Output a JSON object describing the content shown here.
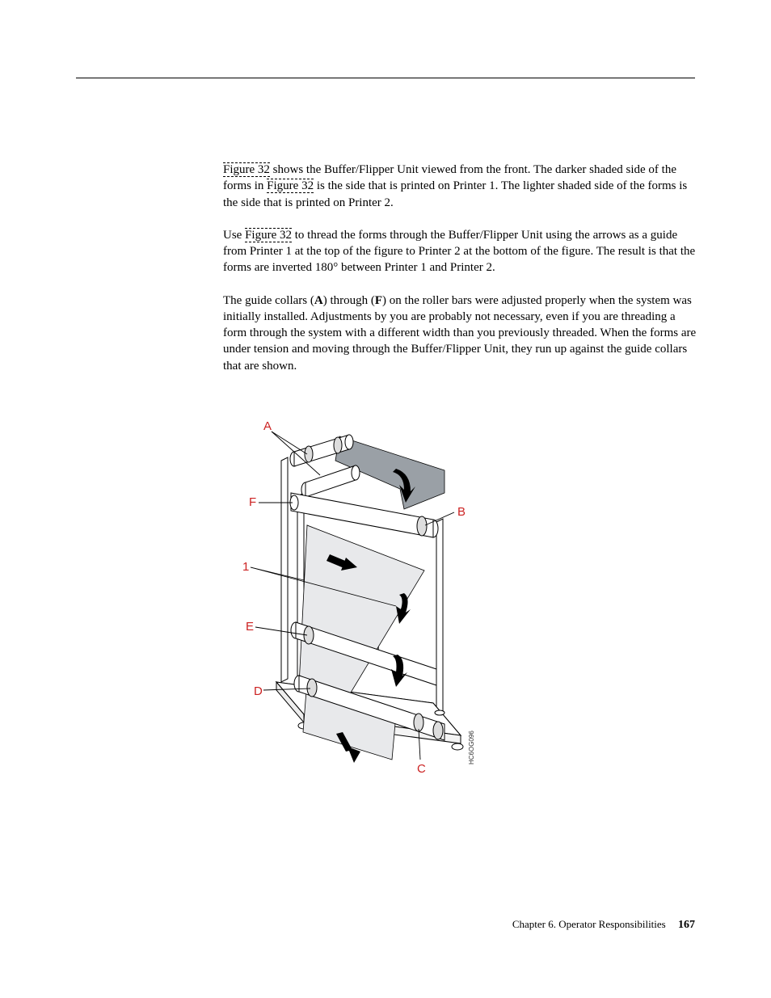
{
  "para1": {
    "link1": "Figure 32",
    "t1": " shows the Buffer/Flipper Unit viewed from the front. The darker shaded side of the forms in ",
    "link2": "Figure 32",
    "t2": " is the side that is printed on Printer 1. The lighter shaded side of the forms is the side that is printed on Printer 2."
  },
  "para2": {
    "t0": "Use ",
    "link1": "Figure 32",
    "t1": " to thread the forms through the Buffer/Flipper Unit using the arrows as a guide from Printer 1 at the top of the figure to Printer 2 at the bottom of the figure. The result is that the forms are inverted 180° between Printer 1 and Printer 2."
  },
  "para3": {
    "t0": "The guide collars (",
    "boldA": "A",
    "t1": ") through (",
    "boldF": "F",
    "t2": ") on the roller bars were adjusted properly when the system was initially installed. Adjustments by you are probably not necessary, even if you are threading a form through the system with a different width than you previously threaded. When the forms are under tension and moving through the Buffer/Flipper Unit, they run up against the guide collars that are shown."
  },
  "figure": {
    "labels": {
      "A": "A",
      "B": "B",
      "C": "C",
      "D": "D",
      "E": "E",
      "F": "F",
      "one": "1"
    },
    "code": "HC6OG096"
  },
  "footer": {
    "chapter": "Chapter 6. Operator Responsibilities",
    "page": "167"
  }
}
